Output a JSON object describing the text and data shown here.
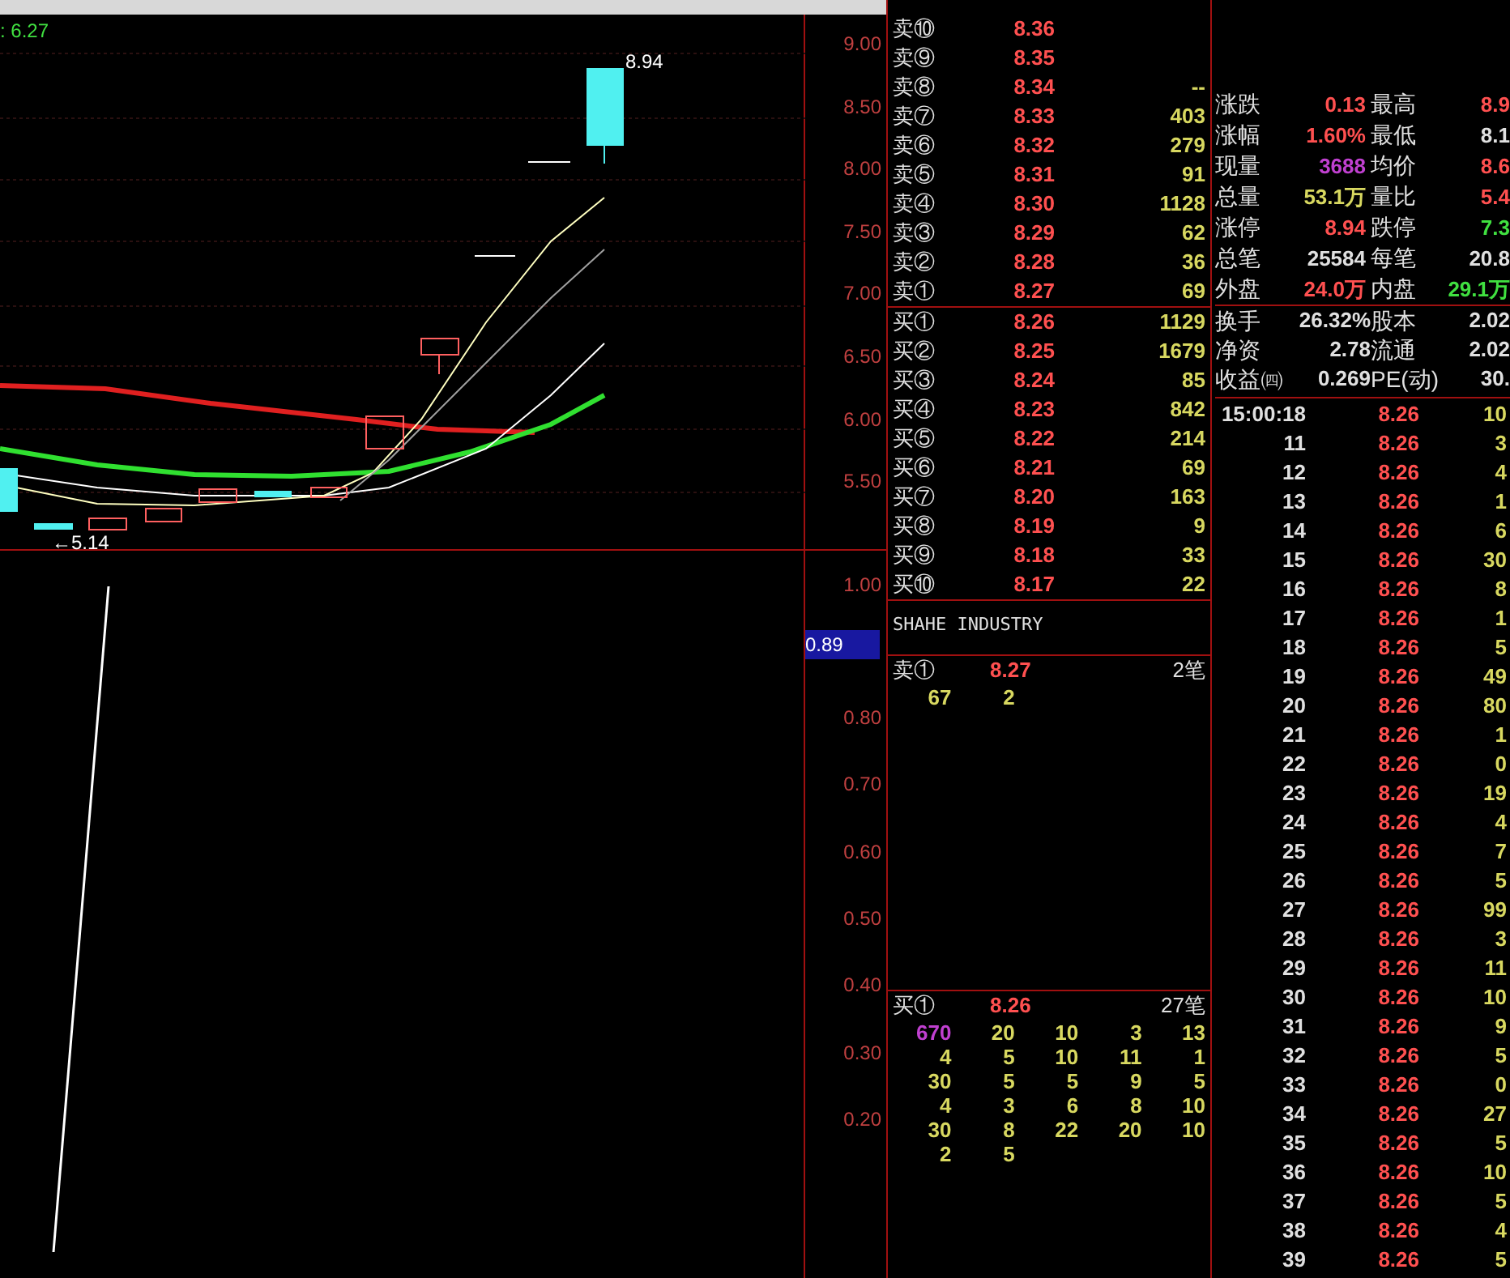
{
  "main_chart": {
    "indicator_label": ": 6.27",
    "high_label": "8.94",
    "low_label": "←5.14",
    "y_axis": [
      "9.00",
      "8.50",
      "8.00",
      "7.50",
      "7.00",
      "6.50",
      "6.00",
      "5.50"
    ]
  },
  "sub_chart": {
    "y_axis": [
      "1.00",
      "0.80",
      "0.70",
      "0.60",
      "0.50",
      "0.40",
      "0.30",
      "0.20"
    ],
    "current": "0.89"
  },
  "order_book": {
    "asks": [
      {
        "label": "卖⑩",
        "price": "8.36"
      },
      {
        "label": "卖⑨",
        "price": "8.35"
      },
      {
        "label": "卖⑧",
        "price": "8.34",
        "volume": "--"
      },
      {
        "label": "卖⑦",
        "price": "8.33",
        "volume": "403"
      },
      {
        "label": "卖⑥",
        "price": "8.32",
        "volume": "279"
      },
      {
        "label": "卖⑤",
        "price": "8.31",
        "volume": "91"
      },
      {
        "label": "卖④",
        "price": "8.30",
        "volume": "1128"
      },
      {
        "label": "卖③",
        "price": "8.29",
        "volume": "62"
      },
      {
        "label": "卖②",
        "price": "8.28",
        "volume": "36"
      },
      {
        "label": "卖①",
        "price": "8.27",
        "volume": "69"
      }
    ],
    "bids": [
      {
        "label": "买①",
        "price": "8.26",
        "volume": "1129"
      },
      {
        "label": "买②",
        "price": "8.25",
        "volume": "1679"
      },
      {
        "label": "买③",
        "price": "8.24",
        "volume": "85"
      },
      {
        "label": "买④",
        "price": "8.23",
        "volume": "842"
      },
      {
        "label": "买⑤",
        "price": "8.22",
        "volume": "214"
      },
      {
        "label": "买⑥",
        "price": "8.21",
        "volume": "69"
      },
      {
        "label": "买⑦",
        "price": "8.20",
        "volume": "163"
      },
      {
        "label": "买⑧",
        "price": "8.19",
        "volume": "9"
      },
      {
        "label": "买⑨",
        "price": "8.18",
        "volume": "33"
      },
      {
        "label": "买⑩",
        "price": "8.17",
        "volume": "22"
      }
    ]
  },
  "company_name": "SHAHE INDUSTRY",
  "queues": [
    {
      "label": "卖①",
      "price": "8.27",
      "count": "2笔",
      "orders": [
        {
          "value": "67",
          "large": false
        },
        {
          "value": "2",
          "large": false
        }
      ]
    },
    {
      "label": "买①",
      "price": "8.26",
      "count": "27笔",
      "orders": [
        {
          "value": "670",
          "large": true
        },
        {
          "value": "20",
          "large": false
        },
        {
          "value": "10",
          "large": false
        },
        {
          "value": "3",
          "large": false
        },
        {
          "value": "13",
          "large": false
        },
        {
          "value": "4",
          "large": false
        },
        {
          "value": "5",
          "large": false
        },
        {
          "value": "10",
          "large": false
        },
        {
          "value": "11",
          "large": false
        },
        {
          "value": "1",
          "large": false
        },
        {
          "value": "30",
          "large": false
        },
        {
          "value": "5",
          "large": false
        },
        {
          "value": "5",
          "large": false
        },
        {
          "value": "9",
          "large": false
        },
        {
          "value": "5",
          "large": false
        },
        {
          "value": "4",
          "large": false
        },
        {
          "value": "3",
          "large": false
        },
        {
          "value": "6",
          "large": false
        },
        {
          "value": "8",
          "large": false
        },
        {
          "value": "10",
          "large": false
        },
        {
          "value": "30",
          "large": false
        },
        {
          "value": "8",
          "large": false
        },
        {
          "value": "22",
          "large": false
        },
        {
          "value": "20",
          "large": false
        },
        {
          "value": "10",
          "large": false
        },
        {
          "value": "2",
          "large": false
        },
        {
          "value": "5",
          "large": false
        }
      ]
    }
  ],
  "stats": [
    [
      {
        "label": "涨跌",
        "value": "0.13",
        "color": "#ff5050"
      },
      {
        "label": "最高",
        "value": "8.9",
        "color": "#ff5050"
      }
    ],
    [
      {
        "label": "涨幅",
        "value": "1.60%",
        "color": "#ff5050"
      },
      {
        "label": "最低",
        "value": "8.1",
        "color": "#e0e0e0"
      }
    ],
    [
      {
        "label": "现量",
        "value": "3688",
        "color": "#c040d0"
      },
      {
        "label": "均价",
        "value": "8.6",
        "color": "#ff5050"
      }
    ],
    [
      {
        "label": "总量",
        "value": "53.1万",
        "color": "#d8d860"
      },
      {
        "label": "量比",
        "value": "5.4",
        "color": "#ff5050"
      }
    ],
    [
      {
        "label": "涨停",
        "value": "8.94",
        "color": "#ff5050"
      },
      {
        "label": "跌停",
        "value": "7.3",
        "color": "#40e040"
      }
    ],
    [
      {
        "label": "总笔",
        "value": "25584",
        "color": "#e0e0e0"
      },
      {
        "label": "每笔",
        "value": "20.8",
        "color": "#e0e0e0"
      }
    ],
    [
      {
        "label": "外盘",
        "value": "24.0万",
        "color": "#ff5050"
      },
      {
        "label": "内盘",
        "value": "29.1万",
        "color": "#40e040"
      }
    ]
  ],
  "fundamentals": [
    [
      {
        "label": "换手",
        "value": "26.32%"
      },
      {
        "label": "股本",
        "value": "2.02"
      }
    ],
    [
      {
        "label": "净资",
        "value": "2.78"
      },
      {
        "label": "流通",
        "value": "2.02"
      }
    ],
    [
      {
        "label": "收益㈣",
        "value": "0.269"
      },
      {
        "label": "PE(动)",
        "value": "30."
      }
    ]
  ],
  "ticks": [
    {
      "time": "15:00:18",
      "price": "8.26",
      "volume": "10"
    },
    {
      "time": "11",
      "price": "8.26",
      "volume": "3"
    },
    {
      "time": "12",
      "price": "8.26",
      "volume": "4"
    },
    {
      "time": "13",
      "price": "8.26",
      "volume": "1"
    },
    {
      "time": "14",
      "price": "8.26",
      "volume": "6"
    },
    {
      "time": "15",
      "price": "8.26",
      "volume": "30"
    },
    {
      "time": "16",
      "price": "8.26",
      "volume": "8"
    },
    {
      "time": "17",
      "price": "8.26",
      "volume": "1"
    },
    {
      "time": "18",
      "price": "8.26",
      "volume": "5"
    },
    {
      "time": "19",
      "price": "8.26",
      "volume": "49"
    },
    {
      "time": "20",
      "price": "8.26",
      "volume": "80"
    },
    {
      "time": "21",
      "price": "8.26",
      "volume": "1"
    },
    {
      "time": "22",
      "price": "8.26",
      "volume": "0"
    },
    {
      "time": "23",
      "price": "8.26",
      "volume": "19"
    },
    {
      "time": "24",
      "price": "8.26",
      "volume": "4"
    },
    {
      "time": "25",
      "price": "8.26",
      "volume": "7"
    },
    {
      "time": "26",
      "price": "8.26",
      "volume": "5"
    },
    {
      "time": "27",
      "price": "8.26",
      "volume": "99"
    },
    {
      "time": "28",
      "price": "8.26",
      "volume": "3"
    },
    {
      "time": "29",
      "price": "8.26",
      "volume": "11"
    },
    {
      "time": "30",
      "price": "8.26",
      "volume": "10"
    },
    {
      "time": "31",
      "price": "8.26",
      "volume": "9"
    },
    {
      "time": "32",
      "price": "8.26",
      "volume": "5"
    },
    {
      "time": "33",
      "price": "8.26",
      "volume": "0"
    },
    {
      "time": "34",
      "price": "8.26",
      "volume": "27"
    },
    {
      "time": "35",
      "price": "8.26",
      "volume": "5"
    },
    {
      "time": "36",
      "price": "8.26",
      "volume": "10"
    },
    {
      "time": "37",
      "price": "8.26",
      "volume": "5"
    },
    {
      "time": "38",
      "price": "8.26",
      "volume": "4"
    },
    {
      "time": "39",
      "price": "8.26",
      "volume": "5"
    }
  ]
}
